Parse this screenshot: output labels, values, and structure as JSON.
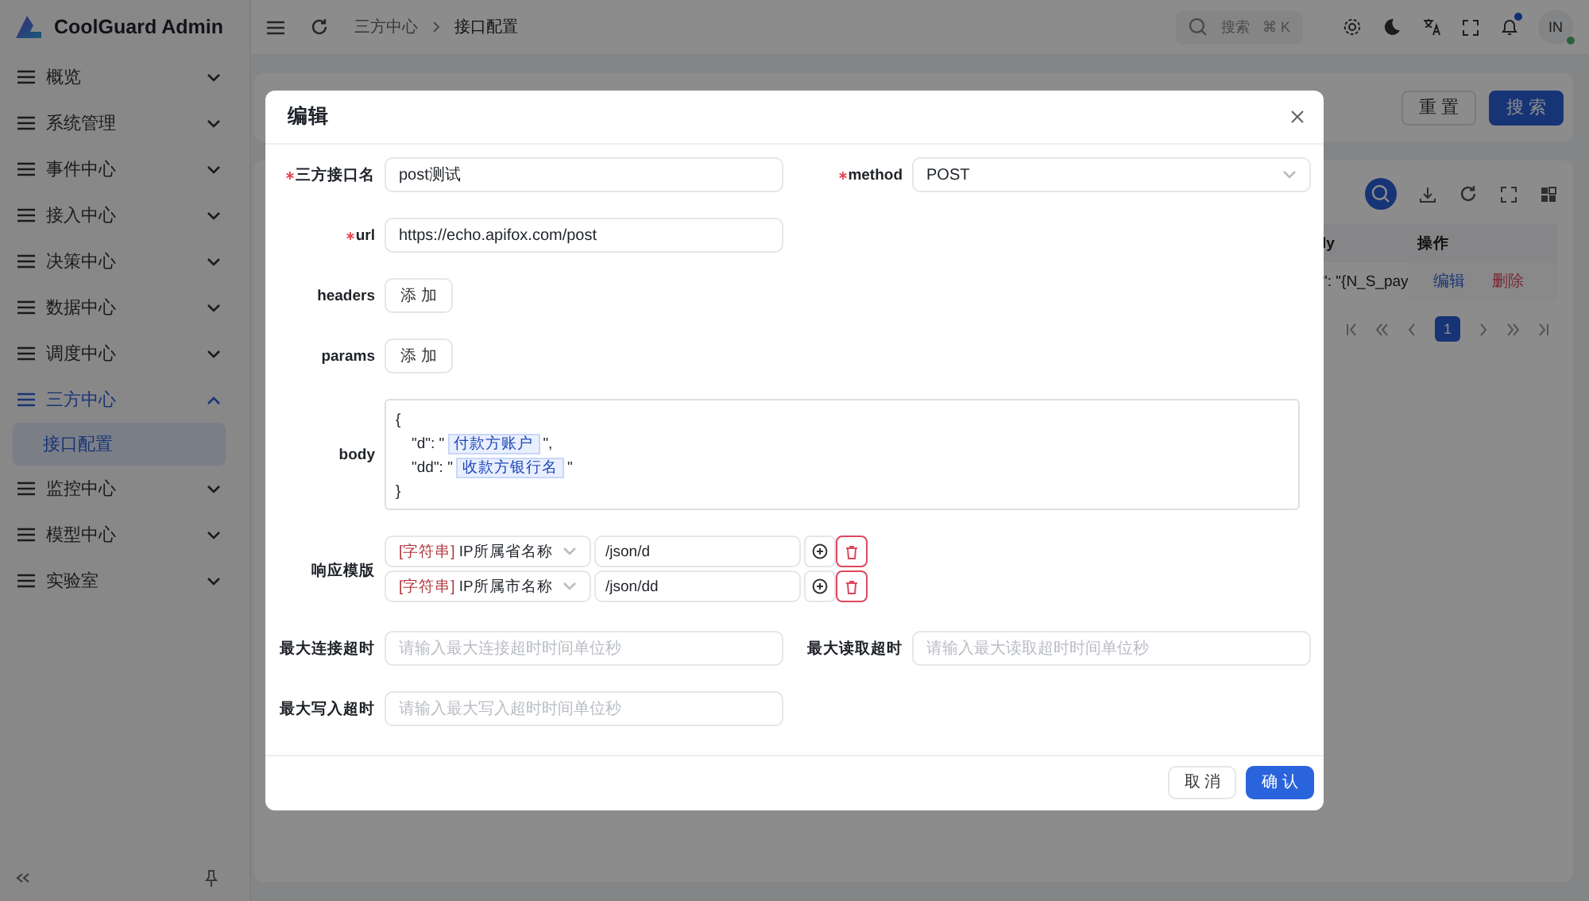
{
  "app": {
    "title": "CoolGuard Admin"
  },
  "sidebar": {
    "items": [
      {
        "label": "概览",
        "expanded": false,
        "selected": false
      },
      {
        "label": "系统管理",
        "expanded": false,
        "selected": false
      },
      {
        "label": "事件中心",
        "expanded": false,
        "selected": false
      },
      {
        "label": "接入中心",
        "expanded": false,
        "selected": false
      },
      {
        "label": "决策中心",
        "expanded": false,
        "selected": false
      },
      {
        "label": "数据中心",
        "expanded": false,
        "selected": false
      },
      {
        "label": "调度中心",
        "expanded": false,
        "selected": false
      },
      {
        "label": "三方中心",
        "expanded": true,
        "selected": true,
        "children": [
          {
            "label": "接口配置",
            "selected": true
          }
        ]
      },
      {
        "label": "监控中心",
        "expanded": false,
        "selected": false
      },
      {
        "label": "模型中心",
        "expanded": false,
        "selected": false
      },
      {
        "label": "实验室",
        "expanded": false,
        "selected": false
      }
    ]
  },
  "header": {
    "breadcrumb": [
      "三方中心",
      "接口配置"
    ],
    "search": {
      "placeholder": "搜索",
      "shortcut": "⌘ K"
    },
    "unread_notifications": true,
    "user": {
      "initials": "IN",
      "online": true
    }
  },
  "search_card": {
    "buttons": [
      {
        "label": "重 置",
        "kind": "default"
      },
      {
        "label": "搜 索",
        "kind": "primary"
      }
    ]
  },
  "table": {
    "columns": [
      "ly",
      "操作"
    ],
    "rows": [
      {
        "cells": [
          "\": \"{N_S_pay"
        ],
        "actions": [
          "编辑",
          "删除"
        ]
      }
    ],
    "pagination": {
      "pages": [
        {
          "label": "1",
          "selected": true
        }
      ]
    }
  },
  "modal": {
    "title": "编辑",
    "name": {
      "label": "三方接口名",
      "required": true,
      "value": "post测试"
    },
    "method": {
      "label": "method",
      "required": true,
      "value": "POST"
    },
    "url": {
      "label": "url",
      "required": true,
      "value": "https://echo.apifox.com/post"
    },
    "headers": {
      "label": "headers",
      "button": "添 加"
    },
    "params": {
      "label": "params",
      "button": "添 加"
    },
    "body": {
      "label": "body",
      "lines": [
        {
          "kind": "brace",
          "text": "{"
        },
        {
          "kind": "entry",
          "key": "\"d\": \"",
          "tag": "付款方账户",
          "tail": "\","
        },
        {
          "kind": "entry",
          "key": "\"dd\": \"",
          "tag": "收款方银行名",
          "tail": "\""
        },
        {
          "kind": "brace",
          "text": "}"
        }
      ]
    },
    "response_template": {
      "label": "响应模版",
      "rows": [
        {
          "type": "[字符串]",
          "field": "IP所属省名称",
          "path": "/json/d"
        },
        {
          "type": "[字符串]",
          "field": "IP所属市名称",
          "path": "/json/dd"
        }
      ]
    },
    "connect_timeout": {
      "label": "最大连接超时",
      "placeholder": "请输入最大连接超时时间单位秒"
    },
    "read_timeout": {
      "label": "最大读取超时",
      "placeholder": "请输入最大读取超时时间单位秒"
    },
    "write_timeout": {
      "label": "最大写入超时",
      "placeholder": "请输入最大写入超时时间单位秒"
    },
    "buttons": [
      {
        "label": "取 消",
        "kind": "default"
      },
      {
        "label": "确 认",
        "kind": "primary"
      }
    ]
  }
}
